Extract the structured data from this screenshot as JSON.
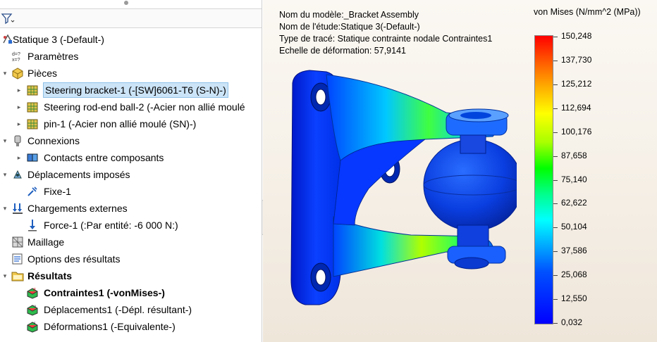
{
  "tree": {
    "items": [
      {
        "label": "Statique 3 (-Default-)",
        "level": 0,
        "icon": "study-icon",
        "arrow": ""
      },
      {
        "label": "Paramètres",
        "level": 1,
        "icon": "parameters-icon",
        "arrow": ""
      },
      {
        "label": "Pièces",
        "level": 1,
        "icon": "parts-icon",
        "arrow": "down"
      },
      {
        "label": "Steering bracket-1 (-[SW]6061-T6 (S-N)-)",
        "level": 2,
        "icon": "part-mesh-icon",
        "arrow": "right",
        "selected": true
      },
      {
        "label": "Steering rod-end ball-2 (-Acier non allié moulé",
        "level": 2,
        "icon": "part-mesh-icon",
        "arrow": "right"
      },
      {
        "label": "pin-1 (-Acier non allié moulé (SN)-)",
        "level": 2,
        "icon": "part-mesh-icon",
        "arrow": "right"
      },
      {
        "label": "Connexions",
        "level": 1,
        "icon": "connections-icon",
        "arrow": "down"
      },
      {
        "label": "Contacts entre composants",
        "level": 2,
        "icon": "contacts-icon",
        "arrow": "right"
      },
      {
        "label": "Déplacements imposés",
        "level": 1,
        "icon": "fixtures-icon",
        "arrow": "down"
      },
      {
        "label": "Fixe-1",
        "level": 2,
        "icon": "fixed-icon",
        "arrow": ""
      },
      {
        "label": "Chargements externes",
        "level": 1,
        "icon": "loads-icon",
        "arrow": "down"
      },
      {
        "label": "Force-1 (:Par entité: -6 000 N:)",
        "level": 2,
        "icon": "force-icon",
        "arrow": ""
      },
      {
        "label": "Maillage",
        "level": 1,
        "icon": "mesh-icon",
        "arrow": ""
      },
      {
        "label": "Options des résultats",
        "level": 1,
        "icon": "result-options-icon",
        "arrow": ""
      },
      {
        "label": "Résultats",
        "level": 1,
        "icon": "results-folder-icon",
        "arrow": "down",
        "bold": true
      },
      {
        "label": "Contraintes1 (-vonMises-)",
        "level": 2,
        "icon": "stress-plot-icon",
        "arrow": "",
        "bold": true
      },
      {
        "label": "Déplacements1 (-Dépl. résultant-)",
        "level": 2,
        "icon": "displacement-plot-icon",
        "arrow": ""
      },
      {
        "label": "Déformations1 (-Equivalente-)",
        "level": 2,
        "icon": "strain-plot-icon",
        "arrow": ""
      }
    ]
  },
  "viewport": {
    "info": {
      "model": "Nom du modèle:_Bracket Assembly",
      "study": "Nom de l'étude:Statique 3(-Default-)",
      "plot": "Type de tracé: Statique contrainte nodale Contraintes1",
      "scale": "Echelle de déformation: 57,9141"
    },
    "legend": {
      "title": "von Mises (N/mm^2 (MPa))",
      "ticks": [
        "150,248",
        "137,730",
        "125,212",
        "112,694",
        "100,176",
        "87,658",
        "75,140",
        "62,622",
        "50,104",
        "37,586",
        "25,068",
        "12,550",
        "0,032"
      ]
    }
  },
  "colors": {
    "selection": "#cce4f7",
    "max_stress": "#ff0000",
    "min_stress": "#0000ff"
  }
}
